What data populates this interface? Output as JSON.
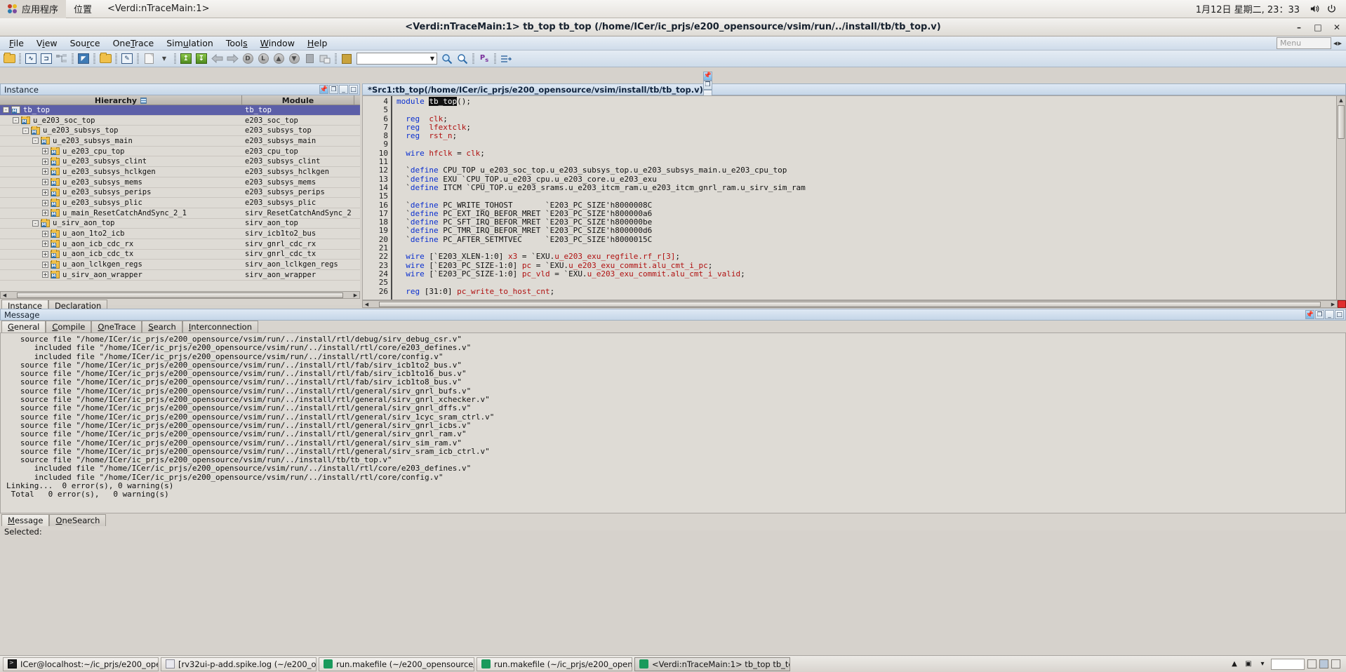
{
  "gnome_panel": {
    "applications": "应用程序",
    "places": "位置",
    "window_name": "<Verdi:nTraceMain:1>",
    "clock": "1月12日 星期二, 23：33",
    "volume_icon": "speaker-icon",
    "power_icon": "power-icon"
  },
  "window": {
    "title": "<Verdi:nTraceMain:1> tb_top tb_top (/home/ICer/ic_prjs/e200_opensource/vsim/run/../install/tb/tb_top.v)",
    "minimize": "–",
    "maximize": "□",
    "close": "✕"
  },
  "menubar": {
    "items": [
      "File",
      "View",
      "Source",
      "OneTrace",
      "Simulation",
      "Tools",
      "Window",
      "Help"
    ],
    "menu_box_placeholder": "Menu",
    "nav_left": "◂",
    "nav_right": "▸"
  },
  "toolbar": {
    "search_value": "",
    "icons": [
      "open-folder-icon",
      "waveform-icon",
      "schematic-icon",
      "hierarchy-icon",
      "source-window-icon",
      "lock-folder-icon",
      "edit-icon",
      "list-icon",
      "dropdown-arrow-icon",
      "step-into-icon",
      "step-out-icon",
      "back-arrow-icon",
      "forward-arrow-icon",
      "driver-icon",
      "load-icon",
      "up-arrow-icon",
      "down-arrow-icon",
      "stop-icon",
      "new-window-icon",
      "book-icon",
      "zoom-icon",
      "find-icon",
      "signal-icon",
      "flow-icon"
    ]
  },
  "instance_panel": {
    "title": "Instance",
    "header_buttons": [
      "pin-icon",
      "undock-icon",
      "minimize-icon",
      "maximize-icon"
    ],
    "columns": [
      "Hierarchy",
      "Module"
    ],
    "tabs": [
      {
        "label": "Instance",
        "active": true
      },
      {
        "label": "Declaration",
        "active": false
      }
    ],
    "rows": [
      {
        "indent": 0,
        "expander": "-",
        "name": "tb_top",
        "module": "tb_top",
        "selected": true,
        "top": true
      },
      {
        "indent": 1,
        "expander": "-",
        "name": "u_e203_soc_top",
        "module": "e203_soc_top",
        "selected": false,
        "top": false
      },
      {
        "indent": 2,
        "expander": "-",
        "name": "u_e203_subsys_top",
        "module": "e203_subsys_top",
        "selected": false,
        "top": false
      },
      {
        "indent": 3,
        "expander": "-",
        "name": "u_e203_subsys_main",
        "module": "e203_subsys_main",
        "selected": false,
        "top": false
      },
      {
        "indent": 4,
        "expander": "+",
        "name": "u_e203_cpu_top",
        "module": "e203_cpu_top",
        "selected": false,
        "top": false
      },
      {
        "indent": 4,
        "expander": "+",
        "name": "u_e203_subsys_clint",
        "module": "e203_subsys_clint",
        "selected": false,
        "top": false
      },
      {
        "indent": 4,
        "expander": "+",
        "name": "u_e203_subsys_hclkgen",
        "module": "e203_subsys_hclkgen",
        "selected": false,
        "top": false
      },
      {
        "indent": 4,
        "expander": "+",
        "name": "u_e203_subsys_mems",
        "module": "e203_subsys_mems",
        "selected": false,
        "top": false
      },
      {
        "indent": 4,
        "expander": "+",
        "name": "u_e203_subsys_perips",
        "module": "e203_subsys_perips",
        "selected": false,
        "top": false
      },
      {
        "indent": 4,
        "expander": "+",
        "name": "u_e203_subsys_plic",
        "module": "e203_subsys_plic",
        "selected": false,
        "top": false
      },
      {
        "indent": 4,
        "expander": "+",
        "name": "u_main_ResetCatchAndSync_2_1",
        "module": "sirv_ResetCatchAndSync_2",
        "selected": false,
        "top": false
      },
      {
        "indent": 3,
        "expander": "-",
        "name": "u_sirv_aon_top",
        "module": "sirv_aon_top",
        "selected": false,
        "top": false
      },
      {
        "indent": 4,
        "expander": "+",
        "name": "u_aon_1to2_icb",
        "module": "sirv_icb1to2_bus",
        "selected": false,
        "top": false
      },
      {
        "indent": 4,
        "expander": "+",
        "name": "u_aon_icb_cdc_rx",
        "module": "sirv_gnrl_cdc_rx",
        "selected": false,
        "top": false
      },
      {
        "indent": 4,
        "expander": "+",
        "name": "u_aon_icb_cdc_tx",
        "module": "sirv_gnrl_cdc_tx",
        "selected": false,
        "top": false
      },
      {
        "indent": 4,
        "expander": "+",
        "name": "u_aon_lclkgen_regs",
        "module": "sirv_aon_lclkgen_regs",
        "selected": false,
        "top": false
      },
      {
        "indent": 4,
        "expander": "+",
        "name": "u_sirv_aon_wrapper",
        "module": "sirv_aon_wrapper",
        "selected": false,
        "top": false
      }
    ]
  },
  "source_panel": {
    "title": "*Src1:tb_top(/home/ICer/ic_prjs/e200_opensource/vsim/install/tb/tb_top.v)",
    "header_buttons": [
      "pin-icon",
      "undock-icon",
      "minimize-icon",
      "maximize-icon"
    ],
    "first_line_no": 4,
    "lines": [
      {
        "n": 4,
        "segments": [
          {
            "t": "kw",
            "s": "module "
          },
          {
            "t": "hl",
            "s": "tb_top"
          },
          {
            "t": "p",
            "s": "();"
          }
        ]
      },
      {
        "n": 5,
        "segments": []
      },
      {
        "n": 6,
        "segments": [
          {
            "t": "p",
            "s": "  "
          },
          {
            "t": "kw",
            "s": "reg"
          },
          {
            "t": "p",
            "s": "  "
          },
          {
            "t": "id",
            "s": "clk"
          },
          {
            "t": "p",
            "s": ";"
          }
        ]
      },
      {
        "n": 7,
        "segments": [
          {
            "t": "p",
            "s": "  "
          },
          {
            "t": "kw",
            "s": "reg"
          },
          {
            "t": "p",
            "s": "  "
          },
          {
            "t": "id",
            "s": "lfextclk"
          },
          {
            "t": "p",
            "s": ";"
          }
        ]
      },
      {
        "n": 8,
        "segments": [
          {
            "t": "p",
            "s": "  "
          },
          {
            "t": "kw",
            "s": "reg"
          },
          {
            "t": "p",
            "s": "  "
          },
          {
            "t": "id",
            "s": "rst_n"
          },
          {
            "t": "p",
            "s": ";"
          }
        ]
      },
      {
        "n": 9,
        "segments": []
      },
      {
        "n": 10,
        "segments": [
          {
            "t": "p",
            "s": "  "
          },
          {
            "t": "kw",
            "s": "wire"
          },
          {
            "t": "p",
            "s": " "
          },
          {
            "t": "id",
            "s": "hfclk"
          },
          {
            "t": "p",
            "s": " = "
          },
          {
            "t": "id",
            "s": "clk"
          },
          {
            "t": "p",
            "s": ";"
          }
        ]
      },
      {
        "n": 11,
        "segments": []
      },
      {
        "n": 12,
        "segments": [
          {
            "t": "p",
            "s": "  `"
          },
          {
            "t": "kw",
            "s": "define"
          },
          {
            "t": "p",
            "s": " CPU_TOP u_e203_soc_top.u_e203_subsys_top.u_e203_subsys_main.u_e203_cpu_top"
          }
        ]
      },
      {
        "n": 13,
        "segments": [
          {
            "t": "p",
            "s": "  `"
          },
          {
            "t": "kw",
            "s": "define"
          },
          {
            "t": "p",
            "s": " EXU `CPU_TOP.u_e203_cpu.u_e203_core.u_e203_exu"
          }
        ]
      },
      {
        "n": 14,
        "segments": [
          {
            "t": "p",
            "s": "  `"
          },
          {
            "t": "kw",
            "s": "define"
          },
          {
            "t": "p",
            "s": " ITCM `CPU_TOP.u_e203_srams.u_e203_itcm_ram.u_e203_itcm_gnrl_ram.u_sirv_sim_ram"
          }
        ]
      },
      {
        "n": 15,
        "segments": []
      },
      {
        "n": 16,
        "segments": [
          {
            "t": "p",
            "s": "  `"
          },
          {
            "t": "kw",
            "s": "define"
          },
          {
            "t": "p",
            "s": " PC_WRITE_TOHOST       `E203_PC_SIZE'h8000008C"
          }
        ]
      },
      {
        "n": 17,
        "segments": [
          {
            "t": "p",
            "s": "  `"
          },
          {
            "t": "kw",
            "s": "define"
          },
          {
            "t": "p",
            "s": " PC_EXT_IRQ_BEFOR_MRET `E203_PC_SIZE'h800000a6"
          }
        ]
      },
      {
        "n": 18,
        "segments": [
          {
            "t": "p",
            "s": "  `"
          },
          {
            "t": "kw",
            "s": "define"
          },
          {
            "t": "p",
            "s": " PC_SFT_IRQ_BEFOR_MRET `E203_PC_SIZE'h800000be"
          }
        ]
      },
      {
        "n": 19,
        "segments": [
          {
            "t": "p",
            "s": "  `"
          },
          {
            "t": "kw",
            "s": "define"
          },
          {
            "t": "p",
            "s": " PC_TMR_IRQ_BEFOR_MRET `E203_PC_SIZE'h800000d6"
          }
        ]
      },
      {
        "n": 20,
        "segments": [
          {
            "t": "p",
            "s": "  `"
          },
          {
            "t": "kw",
            "s": "define"
          },
          {
            "t": "p",
            "s": " PC_AFTER_SETMTVEC     `E203_PC_SIZE'h8000015C"
          }
        ]
      },
      {
        "n": 21,
        "segments": []
      },
      {
        "n": 22,
        "segments": [
          {
            "t": "p",
            "s": "  "
          },
          {
            "t": "kw",
            "s": "wire"
          },
          {
            "t": "p",
            "s": " [`E203_XLEN-1:0] "
          },
          {
            "t": "id",
            "s": "x3"
          },
          {
            "t": "p",
            "s": " = `EXU."
          },
          {
            "t": "id",
            "s": "u_e203_exu_regfile.rf_r[3]"
          },
          {
            "t": "p",
            "s": ";"
          }
        ]
      },
      {
        "n": 23,
        "segments": [
          {
            "t": "p",
            "s": "  "
          },
          {
            "t": "kw",
            "s": "wire"
          },
          {
            "t": "p",
            "s": " [`E203_PC_SIZE-1:0] "
          },
          {
            "t": "id",
            "s": "pc"
          },
          {
            "t": "p",
            "s": " = `EXU."
          },
          {
            "t": "id",
            "s": "u_e203_exu_commit.alu_cmt_i_pc"
          },
          {
            "t": "p",
            "s": ";"
          }
        ]
      },
      {
        "n": 24,
        "segments": [
          {
            "t": "p",
            "s": "  "
          },
          {
            "t": "kw",
            "s": "wire"
          },
          {
            "t": "p",
            "s": " [`E203_PC_SIZE-1:0] "
          },
          {
            "t": "id",
            "s": "pc_vld"
          },
          {
            "t": "p",
            "s": " = `EXU."
          },
          {
            "t": "id",
            "s": "u_e203_exu_commit.alu_cmt_i_valid"
          },
          {
            "t": "p",
            "s": ";"
          }
        ]
      },
      {
        "n": 25,
        "segments": []
      },
      {
        "n": 26,
        "segments": [
          {
            "t": "p",
            "s": "  "
          },
          {
            "t": "kw",
            "s": "reg"
          },
          {
            "t": "p",
            "s": " [31:0] "
          },
          {
            "t": "id",
            "s": "pc_write_to_host_cnt"
          },
          {
            "t": "p",
            "s": ";"
          }
        ]
      }
    ]
  },
  "message_panel": {
    "title": "Message",
    "header_buttons": [
      "pin-icon",
      "undock-icon",
      "minimize-icon",
      "maximize-icon",
      "help-icon"
    ],
    "tabs": [
      {
        "label": "General",
        "active": true
      },
      {
        "label": "Compile",
        "active": false
      },
      {
        "label": "OneTrace",
        "active": false
      },
      {
        "label": "Search",
        "active": false
      },
      {
        "label": "Interconnection",
        "active": false
      }
    ],
    "lines": [
      "   source file \"/home/ICer/ic_prjs/e200_opensource/vsim/run/../install/rtl/debug/sirv_debug_csr.v\"",
      "      included file \"/home/ICer/ic_prjs/e200_opensource/vsim/run/../install/rtl/core/e203_defines.v\"",
      "      included file \"/home/ICer/ic_prjs/e200_opensource/vsim/run/../install/rtl/core/config.v\"",
      "   source file \"/home/ICer/ic_prjs/e200_opensource/vsim/run/../install/rtl/fab/sirv_icb1to2_bus.v\"",
      "   source file \"/home/ICer/ic_prjs/e200_opensource/vsim/run/../install/rtl/fab/sirv_icb1to16_bus.v\"",
      "   source file \"/home/ICer/ic_prjs/e200_opensource/vsim/run/../install/rtl/fab/sirv_icb1to8_bus.v\"",
      "   source file \"/home/ICer/ic_prjs/e200_opensource/vsim/run/../install/rtl/general/sirv_gnrl_bufs.v\"",
      "   source file \"/home/ICer/ic_prjs/e200_opensource/vsim/run/../install/rtl/general/sirv_gnrl_xchecker.v\"",
      "   source file \"/home/ICer/ic_prjs/e200_opensource/vsim/run/../install/rtl/general/sirv_gnrl_dffs.v\"",
      "   source file \"/home/ICer/ic_prjs/e200_opensource/vsim/run/../install/rtl/general/sirv_1cyc_sram_ctrl.v\"",
      "   source file \"/home/ICer/ic_prjs/e200_opensource/vsim/run/../install/rtl/general/sirv_gnrl_icbs.v\"",
      "   source file \"/home/ICer/ic_prjs/e200_opensource/vsim/run/../install/rtl/general/sirv_gnrl_ram.v\"",
      "   source file \"/home/ICer/ic_prjs/e200_opensource/vsim/run/../install/rtl/general/sirv_sim_ram.v\"",
      "   source file \"/home/ICer/ic_prjs/e200_opensource/vsim/run/../install/rtl/general/sirv_sram_icb_ctrl.v\"",
      "   source file \"/home/ICer/ic_prjs/e200_opensource/vsim/run/../install/tb/tb_top.v\"",
      "      included file \"/home/ICer/ic_prjs/e200_opensource/vsim/run/../install/rtl/core/e203_defines.v\"",
      "      included file \"/home/ICer/ic_prjs/e200_opensource/vsim/run/../install/rtl/core/config.v\"",
      "Linking...  0 error(s), 0 warning(s)",
      " Total   0 error(s),   0 warning(s)"
    ],
    "bottom_tabs": [
      {
        "label": "Message",
        "active": true
      },
      {
        "label": "OneSearch",
        "active": false
      }
    ]
  },
  "status_bar": {
    "selected_label": "Selected:"
  },
  "taskbar": {
    "tasks": [
      {
        "label": "ICer@localhost:~/ic_prjs/e200_ope…",
        "icon": "terminal-icon",
        "active": false
      },
      {
        "label": "[rv32ui-p-add.spike.log (~/e200_op…",
        "icon": "document-icon",
        "active": false
      },
      {
        "label": "run.makefile (~/e200_opensource/…",
        "icon": "verdi-icon",
        "active": false
      },
      {
        "label": "run.makefile (~/ic_prjs/e200_opens…",
        "icon": "verdi-icon",
        "active": false
      },
      {
        "label": "<Verdi:nTraceMain:1> tb_top tb_to…",
        "icon": "verdi-icon",
        "active": true
      }
    ],
    "right_icons": [
      "up-arrow-icon",
      "workspace-icon",
      "chevron-down-icon",
      "panel-a-icon",
      "panel-b-icon",
      "panel-c-icon"
    ]
  },
  "colors": {
    "selection_blue": "#5c5fa8",
    "keyword_blue": "#0a2fd0",
    "identifier_red": "#b01010",
    "panel_blue": "#c5d6e8",
    "error_red": "#e03030"
  }
}
